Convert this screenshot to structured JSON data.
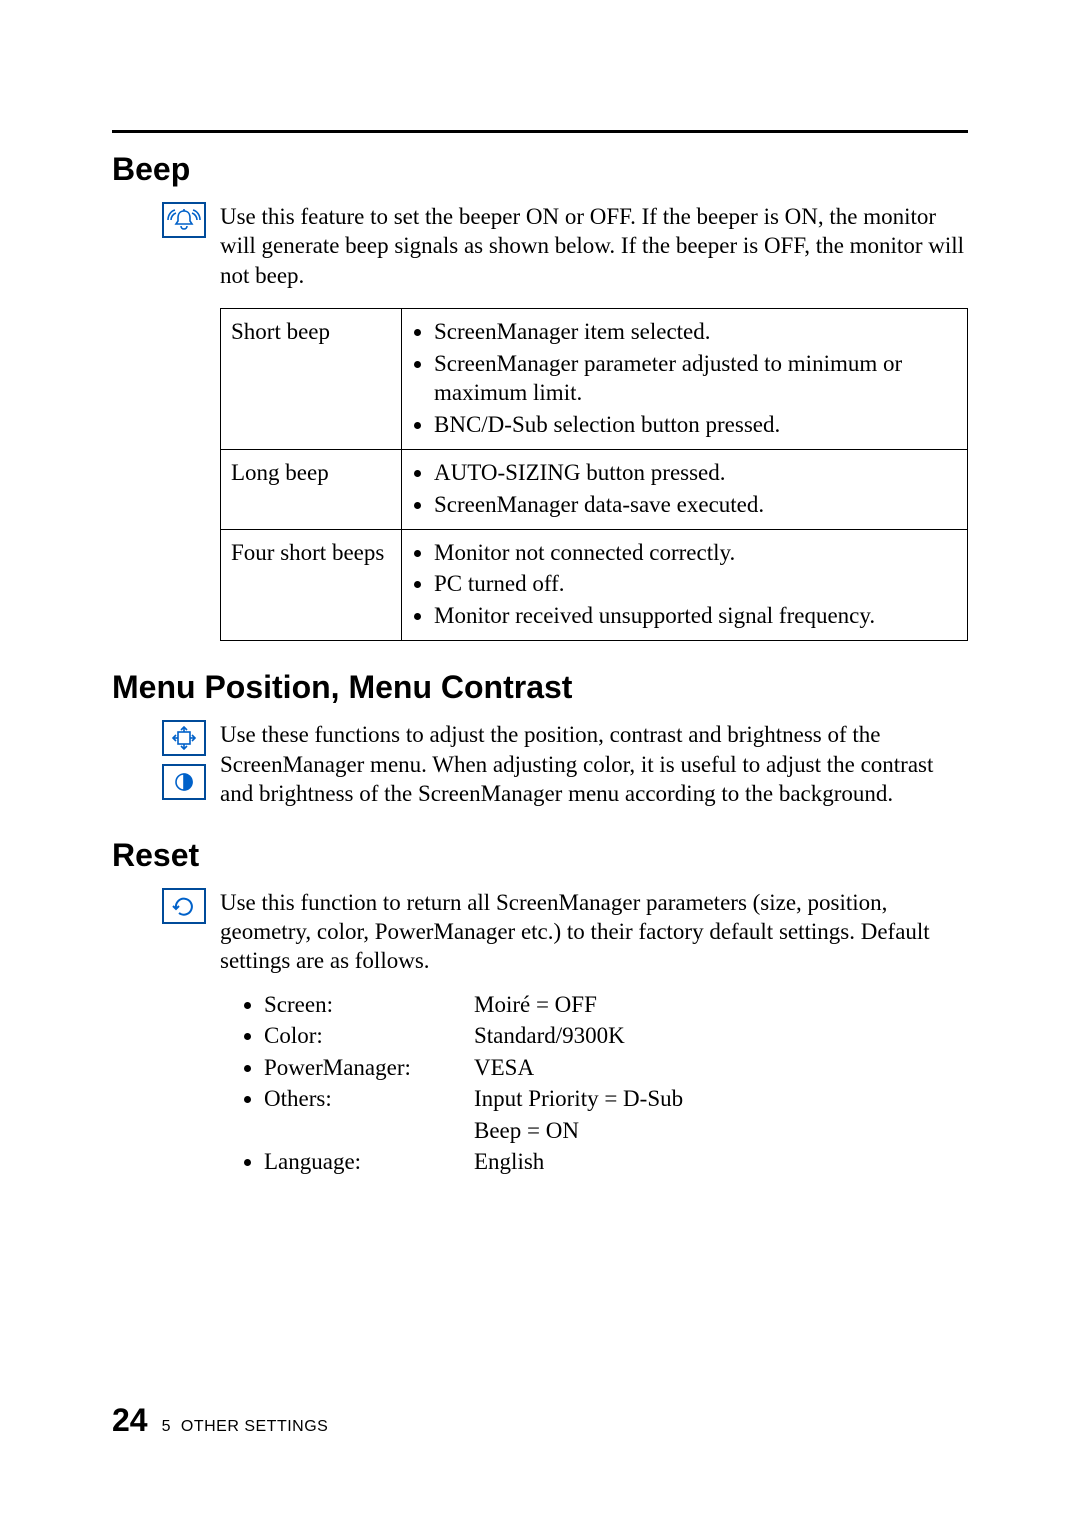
{
  "sections": {
    "beep": {
      "heading": "Beep",
      "intro": "Use this feature to set the beeper ON or OFF.  If the beeper is ON, the monitor will generate beep signals as shown below.  If the beeper is OFF, the monitor will not beep.",
      "table": [
        {
          "label": "Short beep",
          "items": [
            "ScreenManager item selected.",
            "ScreenManager parameter adjusted to minimum or maximum limit.",
            "BNC/D-Sub selection button pressed."
          ]
        },
        {
          "label": "Long beep",
          "items": [
            "AUTO-SIZING button pressed.",
            "ScreenManager data-save executed."
          ]
        },
        {
          "label": "Four short beeps",
          "items": [
            "Monitor not connected correctly.",
            "PC turned off.",
            "Monitor received unsupported signal frequency."
          ]
        }
      ]
    },
    "menu": {
      "heading": "Menu Position, Menu Contrast",
      "intro": "Use these functions to adjust the position, contrast and brightness of the ScreenManager menu.  When adjusting color, it is useful to adjust the contrast and brightness of the ScreenManager menu according to the background."
    },
    "reset": {
      "heading": "Reset",
      "intro": "Use this function to return all ScreenManager parameters (size, position, geometry, color, PowerManager etc.) to their factory default settings.  Default settings are as follows.",
      "defaults": [
        {
          "label": "Screen:",
          "value": "Moiré = OFF"
        },
        {
          "label": "Color:",
          "value": "Standard/9300K"
        },
        {
          "label": "PowerManager:",
          "value": "VESA"
        },
        {
          "label": "Others:",
          "value": "Input Priority = D-Sub"
        },
        {
          "label": "",
          "value": "Beep = ON"
        },
        {
          "label": "Language:",
          "value": "English"
        }
      ]
    }
  },
  "footer": {
    "page": "24",
    "chapter_num": "5",
    "chapter_title": "OTHER SETTINGS"
  }
}
